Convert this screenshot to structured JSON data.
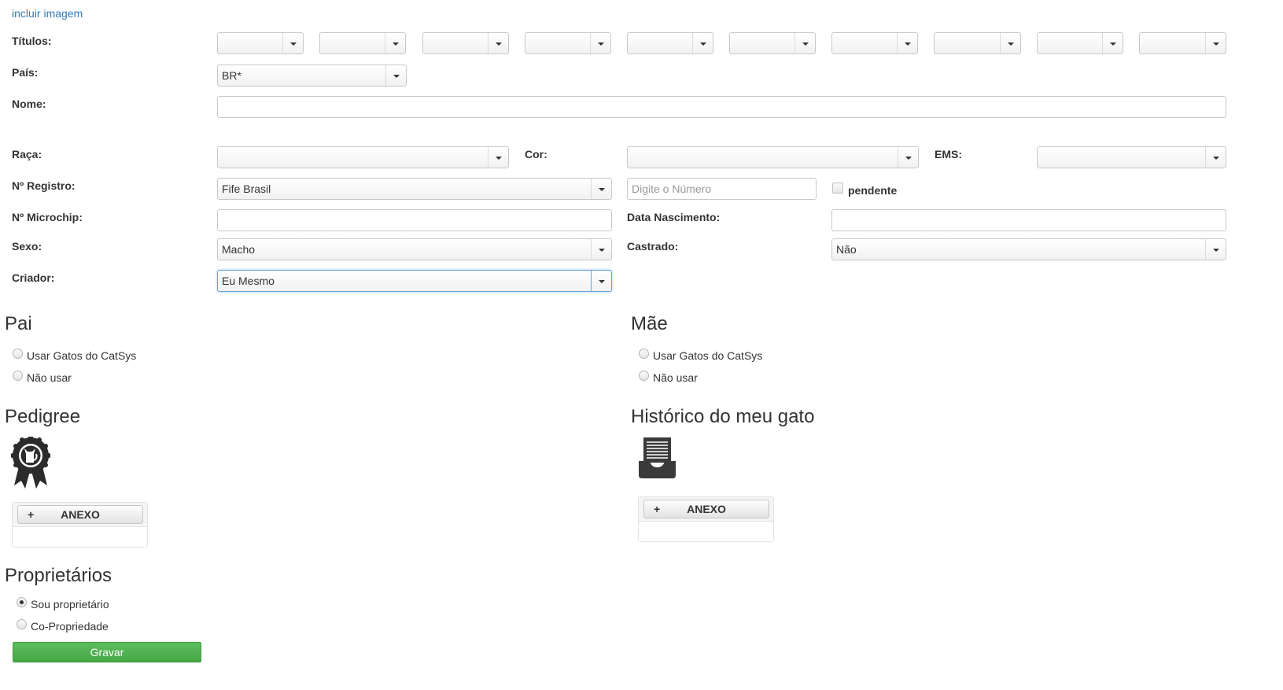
{
  "link_include_image": "incluir imagem",
  "labels": {
    "titulos": "Títulos:",
    "pais": "País:",
    "nome": "Nome:",
    "raca": "Raça:",
    "cor": "Cor:",
    "ems": "EMS:",
    "registro": "Nº Registro:",
    "microchip": "Nº Microchip:",
    "data_nascimento": "Data Nascimento:",
    "sexo": "Sexo:",
    "castrado": "Castrado:",
    "criador": "Criador:"
  },
  "values": {
    "titulos": [
      "",
      "",
      "",
      "",
      "",
      "",
      "",
      "",
      "",
      ""
    ],
    "pais": "BR*",
    "nome": "",
    "raca": "",
    "cor": "",
    "ems": "",
    "registro_org": "Fife Brasil",
    "registro_numero": "",
    "registro_placeholder": "Digite o Número",
    "pendente_label": "pendente",
    "microchip": "",
    "data_nascimento": "",
    "sexo": "Macho",
    "castrado": "Não",
    "criador": "Eu Mesmo"
  },
  "pai": {
    "heading": "Pai",
    "options": [
      "Usar Gatos do CatSys",
      "Não usar"
    ]
  },
  "mae": {
    "heading": "Mãe",
    "options": [
      "Usar Gatos do CatSys",
      "Não usar"
    ]
  },
  "pedigree": {
    "heading": "Pedigree",
    "icon": "ribbon-cat-icon",
    "attach_label": "ANEXO"
  },
  "historico": {
    "heading": "Histórico do meu gato",
    "icon": "inbox-tray-icon",
    "attach_label": "ANEXO"
  },
  "proprietarios": {
    "heading": "Proprietários",
    "options": [
      "Sou proprietário",
      "Co-Propriedade"
    ],
    "selected": "Sou proprietário"
  },
  "save_label": "Gravar",
  "colors": {
    "link": "#337ab7",
    "save_button": "#4cae4c",
    "focus_border": "#66a3e0"
  }
}
